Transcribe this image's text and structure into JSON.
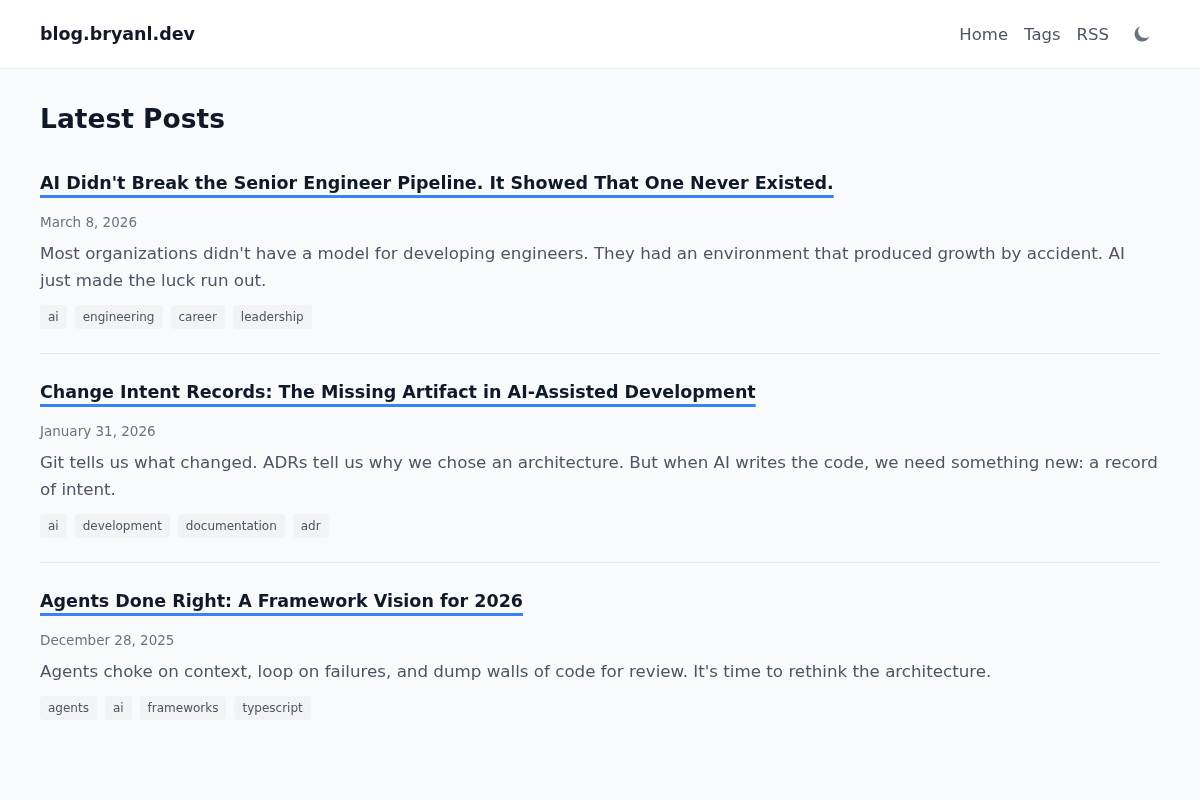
{
  "header": {
    "site_title": "blog.bryanl.dev",
    "nav": [
      "Home",
      "Tags",
      "RSS"
    ]
  },
  "heading": "Latest Posts",
  "posts": [
    {
      "title": "AI Didn't Break the Senior Engineer Pipeline. It Showed That One Never Existed.",
      "date": "March 8, 2026",
      "excerpt": "Most organizations didn't have a model for developing engineers. They had an environment that produced growth by accident. AI just made the luck run out.",
      "tags": [
        "ai",
        "engineering",
        "career",
        "leadership"
      ]
    },
    {
      "title": "Change Intent Records: The Missing Artifact in AI-Assisted Development",
      "date": "January 31, 2026",
      "excerpt": "Git tells us what changed. ADRs tell us why we chose an architecture. But when AI writes the code, we need something new: a record of intent.",
      "tags": [
        "ai",
        "development",
        "documentation",
        "adr"
      ]
    },
    {
      "title": "Agents Done Right: A Framework Vision for 2026",
      "date": "December 28, 2025",
      "excerpt": "Agents choke on context, loop on failures, and dump walls of code for review. It's time to rethink the architecture.",
      "tags": [
        "agents",
        "ai",
        "frameworks",
        "typescript"
      ]
    }
  ]
}
